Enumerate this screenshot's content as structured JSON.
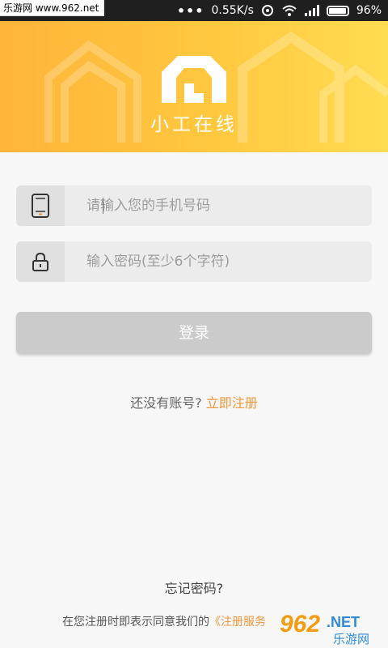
{
  "status_bar": {
    "watermark": "乐游网 www.962.net",
    "dots": "•••",
    "speed": "0.55K/s",
    "battery": "96%",
    "battery_level": 0.96
  },
  "header": {
    "app_name": "小工在线",
    "logo_icon": "house-logo-icon"
  },
  "form": {
    "phone": {
      "icon": "phone-icon",
      "placeholder": "请输入您的手机号码",
      "value": ""
    },
    "password": {
      "icon": "lock-icon",
      "placeholder": "输入密码(至少6个字符)",
      "value": ""
    },
    "login_label": "登录",
    "register_prompt": "还没有账号?",
    "register_link": "立即注册"
  },
  "footer": {
    "forgot": "忘记密码?",
    "terms_prefix": "在您注册时即表示同意我们的",
    "terms_link": "《注册服务"
  },
  "watermark_br": {
    "brand_number": "962",
    "brand_net": ".NET",
    "brand_cn": "乐游网"
  },
  "colors": {
    "accent": "#f0963a",
    "banner_start": "#ffb43a",
    "banner_end": "#ffdc52",
    "button_disabled": "#cbcbcb"
  }
}
